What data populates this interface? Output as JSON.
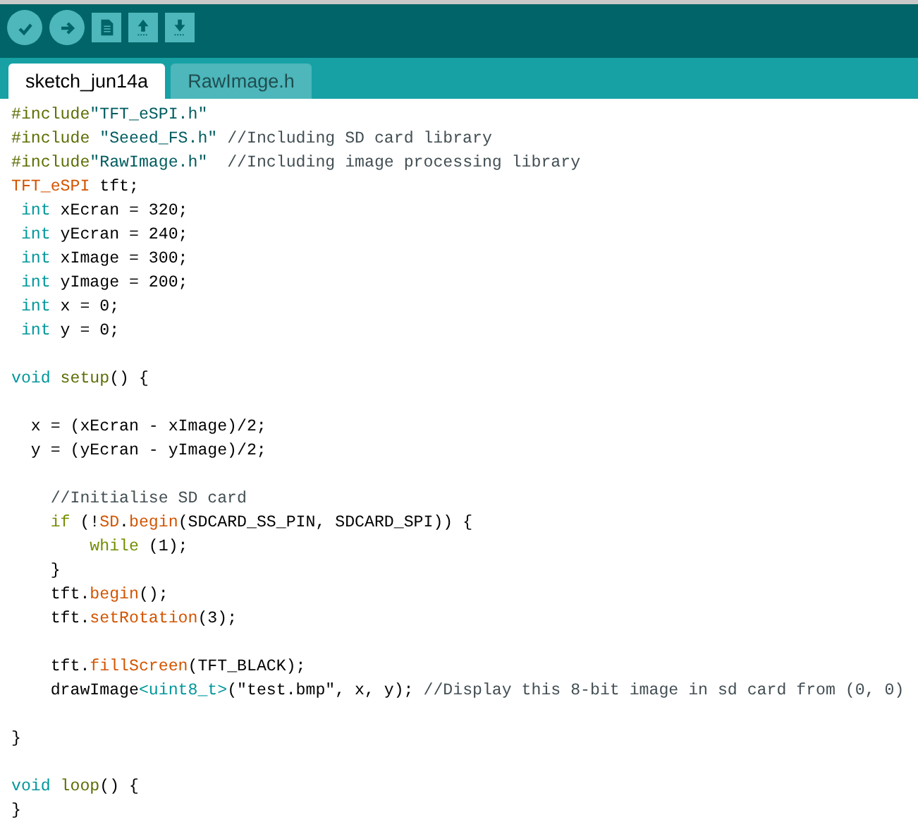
{
  "toolbar": {
    "buttons": [
      {
        "kind": "verify"
      },
      {
        "kind": "upload"
      },
      {
        "kind": "new"
      },
      {
        "kind": "open"
      },
      {
        "kind": "save"
      }
    ]
  },
  "tabs": [
    {
      "label": "sketch_jun14a",
      "selected": true
    },
    {
      "label": "RawImage.h",
      "selected": false
    }
  ],
  "editor": {
    "lines": [
      {
        "kind": "code",
        "tokens": [
          {
            "text": "#include",
            "kind": "directive"
          },
          {
            "text": "\"TFT_eSPI.h\"",
            "kind": "string"
          }
        ]
      },
      {
        "kind": "code",
        "tokens": [
          {
            "text": "#include ",
            "kind": "directive"
          },
          {
            "text": "\"Seeed_FS.h\"",
            "kind": "string"
          },
          {
            "text": " //Including SD card library",
            "kind": "comment"
          }
        ]
      },
      {
        "kind": "code",
        "tokens": [
          {
            "text": "#include",
            "kind": "directive"
          },
          {
            "text": "\"RawImage.h\"",
            "kind": "string"
          },
          {
            "text": "  //Including image processing library",
            "kind": "comment"
          }
        ]
      },
      {
        "kind": "code",
        "tokens": [
          {
            "text": "TFT_eSPI",
            "kind": "function"
          },
          {
            "text": " tft;",
            "kind": "plain"
          }
        ]
      },
      {
        "kind": "code",
        "tokens": [
          {
            "text": " int",
            "kind": "type"
          },
          {
            "text": " xEcran = 320;",
            "kind": "plain"
          }
        ]
      },
      {
        "kind": "code",
        "tokens": [
          {
            "text": " int",
            "kind": "type"
          },
          {
            "text": " yEcran = 240;",
            "kind": "plain"
          }
        ]
      },
      {
        "kind": "code",
        "tokens": [
          {
            "text": " int",
            "kind": "type"
          },
          {
            "text": " xImage = 300;",
            "kind": "plain"
          }
        ]
      },
      {
        "kind": "code",
        "tokens": [
          {
            "text": " int",
            "kind": "type"
          },
          {
            "text": " yImage = 200;",
            "kind": "plain"
          }
        ]
      },
      {
        "kind": "code",
        "tokens": [
          {
            "text": " int",
            "kind": "type"
          },
          {
            "text": " x = 0;",
            "kind": "plain"
          }
        ]
      },
      {
        "kind": "code",
        "tokens": [
          {
            "text": " int",
            "kind": "type"
          },
          {
            "text": " y = 0;",
            "kind": "plain"
          }
        ]
      },
      {
        "kind": "blank"
      },
      {
        "kind": "code",
        "tokens": [
          {
            "text": "void ",
            "kind": "type"
          },
          {
            "text": "setup",
            "kind": "directive"
          },
          {
            "text": "() {",
            "kind": "plain"
          }
        ]
      },
      {
        "kind": "blank"
      },
      {
        "kind": "code",
        "tokens": [
          {
            "text": "  x = (xEcran - xImage)/2;",
            "kind": "plain"
          }
        ]
      },
      {
        "kind": "code",
        "tokens": [
          {
            "text": "  y = (yEcran - yImage)/2;",
            "kind": "plain"
          }
        ]
      },
      {
        "kind": "blank"
      },
      {
        "kind": "code",
        "tokens": [
          {
            "text": "    //Initialise SD card",
            "kind": "comment"
          }
        ]
      },
      {
        "kind": "code",
        "tokens": [
          {
            "text": "    if",
            "kind": "keyword"
          },
          {
            "text": " (!",
            "kind": "plain"
          },
          {
            "text": "SD",
            "kind": "function"
          },
          {
            "text": ".",
            "kind": "plain"
          },
          {
            "text": "begin",
            "kind": "function"
          },
          {
            "text": "(SDCARD_SS_PIN, SDCARD_SPI)) {",
            "kind": "plain"
          }
        ]
      },
      {
        "kind": "code",
        "tokens": [
          {
            "text": "        while",
            "kind": "keyword"
          },
          {
            "text": " (1);",
            "kind": "plain"
          }
        ]
      },
      {
        "kind": "code",
        "tokens": [
          {
            "text": "    }",
            "kind": "plain"
          }
        ]
      },
      {
        "kind": "code",
        "tokens": [
          {
            "text": "    tft.",
            "kind": "plain"
          },
          {
            "text": "begin",
            "kind": "function"
          },
          {
            "text": "();",
            "kind": "plain"
          }
        ]
      },
      {
        "kind": "code",
        "tokens": [
          {
            "text": "    tft.",
            "kind": "plain"
          },
          {
            "text": "setRotation",
            "kind": "function"
          },
          {
            "text": "(3);",
            "kind": "plain"
          }
        ]
      },
      {
        "kind": "blank"
      },
      {
        "kind": "code",
        "tokens": [
          {
            "text": "    tft.",
            "kind": "plain"
          },
          {
            "text": "fillScreen",
            "kind": "function"
          },
          {
            "text": "(TFT_BLACK);",
            "kind": "plain"
          }
        ]
      },
      {
        "kind": "code",
        "tokens": [
          {
            "text": "    drawImage",
            "kind": "plain"
          },
          {
            "text": "<uint8_t>",
            "kind": "type"
          },
          {
            "text": "(\"test.bmp\", x, y); ",
            "kind": "plain"
          },
          {
            "text": "//Display this 8-bit image in sd card from (0, 0)",
            "kind": "comment"
          }
        ]
      },
      {
        "kind": "blank"
      },
      {
        "kind": "code",
        "tokens": [
          {
            "text": "}",
            "kind": "plain"
          }
        ]
      },
      {
        "kind": "blank"
      },
      {
        "kind": "code",
        "tokens": [
          {
            "text": "void ",
            "kind": "type"
          },
          {
            "text": "loop",
            "kind": "directive"
          },
          {
            "text": "() {",
            "kind": "plain"
          }
        ]
      },
      {
        "kind": "code",
        "tokens": [
          {
            "text": "}",
            "kind": "plain"
          }
        ]
      }
    ]
  }
}
